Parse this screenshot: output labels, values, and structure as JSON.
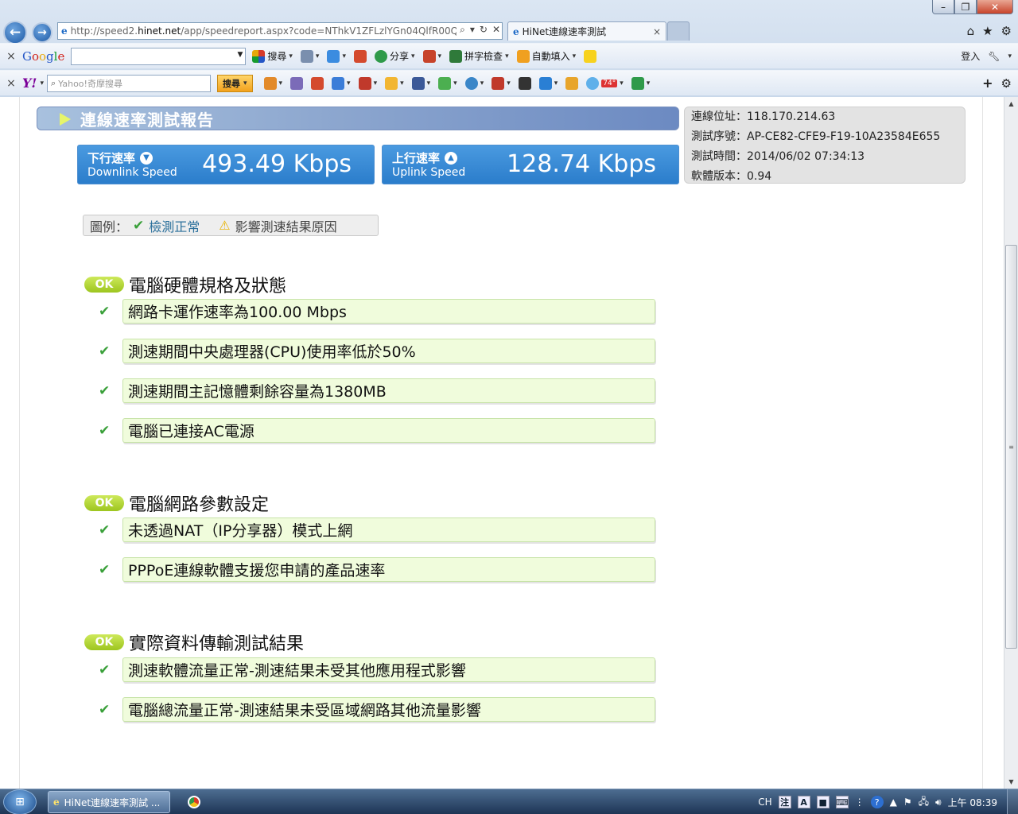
{
  "browser": {
    "address_url_prefix": "http://speed2.",
    "address_url_host": "hinet.net",
    "address_url_rest": "/app/speedreport.aspx?code=NThkV1ZFLzlYGn04QlfR00Q:",
    "tab_title": "HiNet連線速率測試",
    "tab_close": "×",
    "back_glyph": "←",
    "forward_glyph": "→",
    "window_controls": [
      "–",
      "❐",
      "✕"
    ]
  },
  "google_toolbar": {
    "close": "×",
    "logo": [
      "G",
      "o",
      "o",
      "g",
      "l",
      "e"
    ],
    "search_label": "搜尋",
    "share_label": "分享",
    "spellcheck_label": "拼字檢查",
    "autofill_label": "自動填入",
    "signin_label": "登入"
  },
  "yahoo_toolbar": {
    "close": "×",
    "logo": "Y!",
    "search_placeholder": "Yahoo!奇摩搜尋",
    "search_button": "搜尋",
    "weather_badge": "74°"
  },
  "report": {
    "title": "連線速率測試報告",
    "downlink": {
      "label_zh": "下行速率",
      "label_en": "Downlink Speed",
      "value": "493.49 Kbps"
    },
    "uplink": {
      "label_zh": "上行速率",
      "label_en": "Uplink Speed",
      "value": "128.74 Kbps"
    },
    "info": [
      {
        "label": "連線位址：",
        "value": "118.170.214.63"
      },
      {
        "label": "測試序號：",
        "value": "AP-CE82-CFE9-F19-10A23584E655"
      },
      {
        "label": "測試時間：",
        "value": "2014/06/02 07:34:13"
      },
      {
        "label": "軟體版本：",
        "value": "0.94"
      }
    ],
    "legend": {
      "label": "圖例：",
      "ok": "檢測正常",
      "warn": "影響測速結果原因"
    },
    "ok_badge": "OK",
    "sections": [
      {
        "title": "電腦硬體規格及狀態",
        "items": [
          "網路卡運作速率為100.00 Mbps",
          "測速期間中央處理器(CPU)使用率低於50%",
          "測速期間主記憶體剩餘容量為1380MB",
          "電腦已連接AC電源"
        ]
      },
      {
        "title": "電腦網路參數設定",
        "items": [
          "未透過NAT（IP分享器）模式上網",
          "PPPoE連線軟體支援您申請的產品速率"
        ]
      },
      {
        "title": "實際資料傳輸測試結果",
        "items": [
          "測速軟體流量正常-測速結果未受其他應用程式影響",
          "電腦總流量正常-測速結果未受區域網路其他流量影響"
        ]
      }
    ]
  },
  "taskbar": {
    "ie_task": "HiNet連線速率測試 ...",
    "ime": "CH",
    "clock": "上午 08:39"
  },
  "colors": {
    "accent_blue": "#2b7dcb",
    "ok_green": "#9dc51f",
    "item_bg": "#f0fcdc",
    "check_green": "#3aa03a"
  }
}
